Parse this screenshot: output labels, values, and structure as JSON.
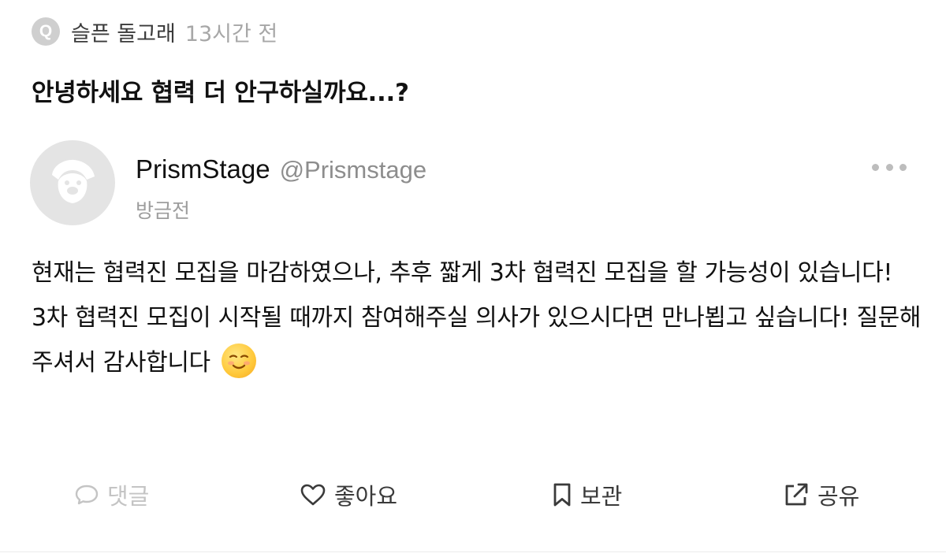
{
  "question_header": {
    "badge": "Q",
    "author": "슬픈 돌고래",
    "time": "13시간 전"
  },
  "question": {
    "text": "안녕하세요 협력 더 안구하실까요...?"
  },
  "reply": {
    "display_name": "PrismStage",
    "handle": "@Prismstage",
    "time": "방금전",
    "paragraph_1": "현재는 협력진 모집을 마감하였으나, 추후 짧게 3차 협력진 모집을 할 가능성이 있습니다!",
    "paragraph_2": "3차 협력진 모집이 시작될 때까지 참여해주실 의사가 있으시다면 만나뵙고 싶습니다! 질문해주셔서 감사합니다"
  },
  "actions": {
    "comment": "댓글",
    "like": "좋아요",
    "save": "보관",
    "share": "공유"
  },
  "icons": {
    "question_badge": "q-badge-icon",
    "avatar": "dog-avatar-icon",
    "more": "more-dots-icon",
    "emoji": "smiling-face-emoji",
    "comment": "comment-bubble-icon",
    "like": "heart-icon",
    "save": "bookmark-icon",
    "share": "share-icon"
  },
  "colors": {
    "muted": "#a7a7a7",
    "text": "#111111",
    "disabled": "#c4c4c4"
  }
}
